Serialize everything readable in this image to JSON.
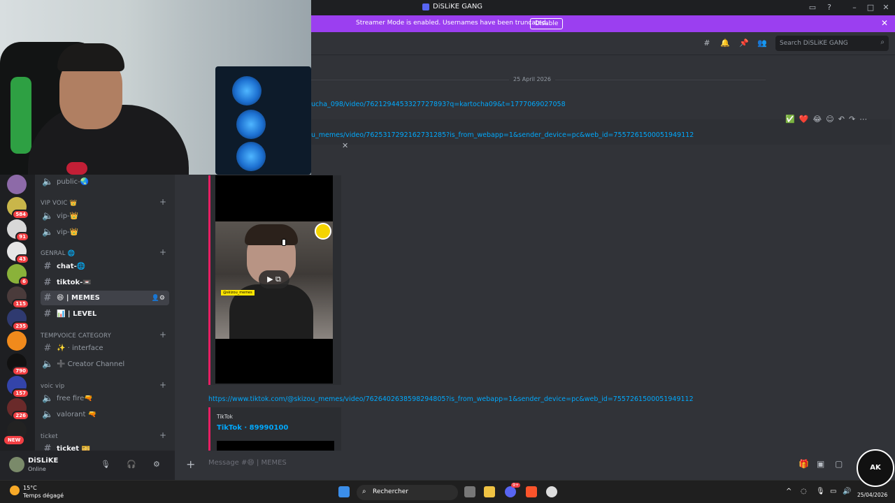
{
  "window": {
    "title": "DiSLiKE GANG"
  },
  "banner": {
    "text": "Streamer Mode is enabled. Usernames have been truncated.",
    "button": "Disable"
  },
  "header": {
    "search_placeholder": "Search DiSLiKE GANG"
  },
  "servers": {
    "badges": [
      "584",
      "91",
      "43",
      "6",
      "115",
      "235",
      "790",
      "157",
      "226"
    ],
    "new_label": "NEW"
  },
  "channels": {
    "items": [
      {
        "type": "voice",
        "label": "public-🌏"
      },
      {
        "type": "category",
        "label": "VIP VOIC 👑"
      },
      {
        "type": "voice",
        "label": "vip-👑"
      },
      {
        "type": "voice",
        "label": "vip-👑"
      },
      {
        "type": "category",
        "label": "GENRAL 🌐"
      },
      {
        "type": "text",
        "label": "chat-🌐"
      },
      {
        "type": "text",
        "label": "tiktok-📼"
      },
      {
        "type": "text",
        "label": "😄 | MEMES"
      },
      {
        "type": "text",
        "label": "📊 | LEVEL"
      },
      {
        "type": "category",
        "label": "TEMPVOICE CATEGORY"
      },
      {
        "type": "text",
        "label": "✨ · interface"
      },
      {
        "type": "voice",
        "label": "➕ Creator Channel"
      },
      {
        "type": "category",
        "label": "voic vip"
      },
      {
        "type": "voice",
        "label": "free fire🔫"
      },
      {
        "type": "voice",
        "label": "valorant 🔫"
      },
      {
        "type": "category",
        "label": "ticket"
      },
      {
        "type": "text",
        "label": "ticket 🎫"
      }
    ]
  },
  "user": {
    "name": "DiSLiKE",
    "status": "Online"
  },
  "chat": {
    "date": "25 April 2026",
    "link1": "ucha_098/video/7621294453327727893?q=kartocha09&t=1777069027058",
    "link2": "u_memes/video/7625317292162731285?is_from_webapp=1&sender_device=pc&web_id=7557261500051949112",
    "video_tag": "@skizou_memes",
    "link3": "https://www.tiktok.com/@skizou_memes/video/7626402638598294805?is_from_webapp=1&sender_device=pc&web_id=7557261500051949112",
    "embed_provider": "TikTok",
    "embed_title": "TikTok · 89990100",
    "reactions": [
      "✅",
      "❤️",
      "😂"
    ]
  },
  "composer": {
    "placeholder": "Message #😄 | MEMES"
  },
  "taskbar": {
    "temp": "15°C",
    "weather": "Temps dégagé",
    "search": "Rechercher",
    "date": "25/04/2026",
    "notif_badge": "9+"
  },
  "overlay": {
    "logo": "AK"
  }
}
